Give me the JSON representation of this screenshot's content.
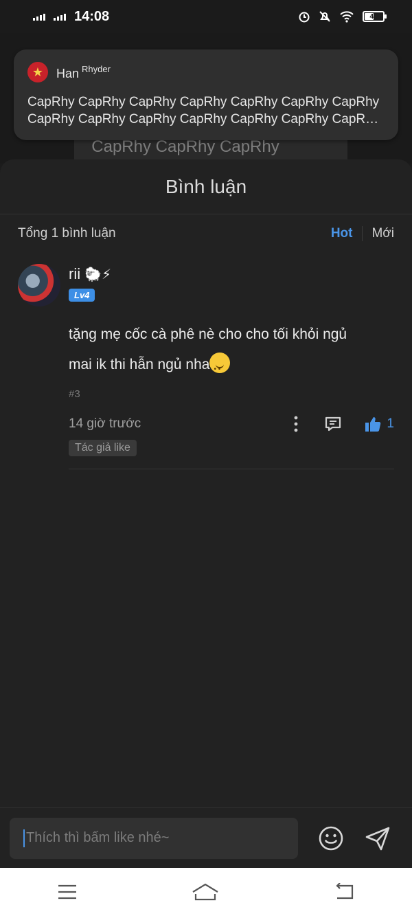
{
  "status_bar": {
    "time": "14:08",
    "battery": "49",
    "icons": [
      "signal-icon",
      "signal-icon",
      "alarm-icon",
      "mute-icon",
      "wifi-icon",
      "battery-icon"
    ]
  },
  "background": {
    "text": "CapRhy CapRhy CapRhy"
  },
  "notification": {
    "app_icon": "app-logo-icon",
    "title": "Han",
    "subtitle": "Rhyder",
    "line1": "CapRhy CapRhy CapRhy CapRhy CapRhy CapRhy CapRhy",
    "line2": "CapRhy CapRhy CapRhy CapRhy CapRhy CapRhy CapRhy..."
  },
  "sheet": {
    "title": "Bình luận",
    "count_text": "Tổng 1 bình luận",
    "sort_hot": "Hot",
    "sort_new": "Mới"
  },
  "comments": [
    {
      "username": "rii",
      "user_emoji": "🐑⚡",
      "level": "Lv4",
      "text_line1": "tặng mẹ cốc cà phê nè cho cho tối khỏi ngủ",
      "text_line2": "mai ik thi hẫn ngủ nha",
      "index": "#3",
      "time": "14 giờ trước",
      "likes": "1",
      "tag": "Tác giả like"
    }
  ],
  "input": {
    "placeholder": "Thích thì bấm like nhé~"
  },
  "colors": {
    "accent": "#4a95e8",
    "background": "#222222"
  }
}
